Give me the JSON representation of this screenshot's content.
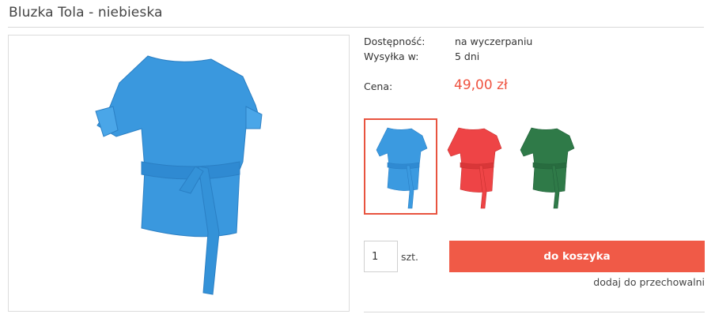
{
  "product": {
    "title": "Bluzka Tola - niebieska",
    "main_image_color": "#3a98de"
  },
  "details": {
    "availability_label": "Dostępność:",
    "availability_value": "na wyczerpaniu",
    "shipping_label": "Wysyłka w:",
    "shipping_value": "5 dni",
    "price_label": "Cena:",
    "price_value": "49,00 zł",
    "price_color": "#ef5340"
  },
  "variants": [
    {
      "color": "#3b9ae0",
      "selected": true
    },
    {
      "color": "#ee4446",
      "selected": false
    },
    {
      "color": "#2f7a48",
      "selected": false
    }
  ],
  "purchase": {
    "quantity": "1",
    "unit": "szt.",
    "add_to_cart_label": "do koszyka",
    "add_to_cart_color": "#f05a47",
    "wishlist_link": "dodaj do przechowalni"
  }
}
